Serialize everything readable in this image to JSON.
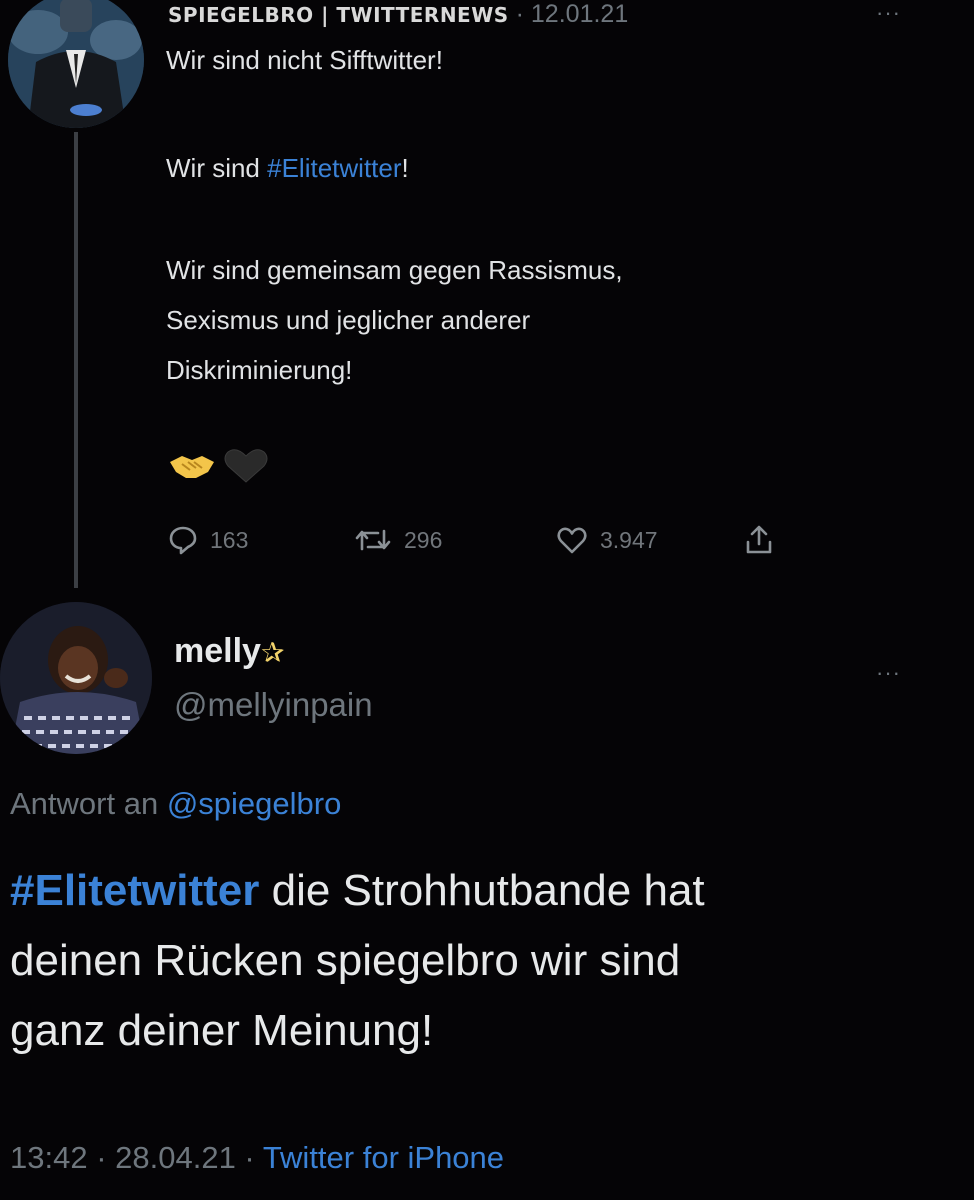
{
  "parent_tweet": {
    "author": "SPIEGELBRO | TWITTERNEWS",
    "separator": " · ",
    "date": "12.01.21",
    "more_label": "···",
    "lines": [
      {
        "pre": "Wir sind nicht Sifftwitter!",
        "hashtag": "",
        "post": ""
      },
      {
        "pre": "Wir sind ",
        "hashtag": "#Elitetwitter",
        "post": "!"
      },
      {
        "pre": "Wir sind gemeinsam gegen Rassismus,",
        "hashtag": "",
        "post": ""
      },
      {
        "pre": "Sexismus und jeglicher anderer",
        "hashtag": "",
        "post": ""
      },
      {
        "pre": "Diskriminierung!",
        "hashtag": "",
        "post": ""
      }
    ],
    "emojis": [
      "handshake-emoji",
      "black-heart-emoji"
    ],
    "stats": {
      "replies": "163",
      "retweets": "296",
      "likes": "3.947"
    }
  },
  "reply_tweet": {
    "name": "melly",
    "name_icon": "sparkle-star-icon",
    "name_suffix": "✰",
    "handle": "@mellyinpain",
    "more_label": "···",
    "reply_to_label": "Antwort an ",
    "reply_to_handle": "@spiegelbro",
    "hashtag": "#Elitetwitter",
    "text_lines": [
      " die Strohhutbande hat",
      "deinen Rücken spiegelbro wir sind",
      "ganz deiner Meinung!"
    ],
    "time": "13:42",
    "date": "28.04.21",
    "meta_separator": " · ",
    "source": "Twitter for iPhone"
  },
  "colors": {
    "background": "#050406",
    "text": "#e7e9ea",
    "muted": "#6e767d",
    "link": "#3b82d6"
  }
}
